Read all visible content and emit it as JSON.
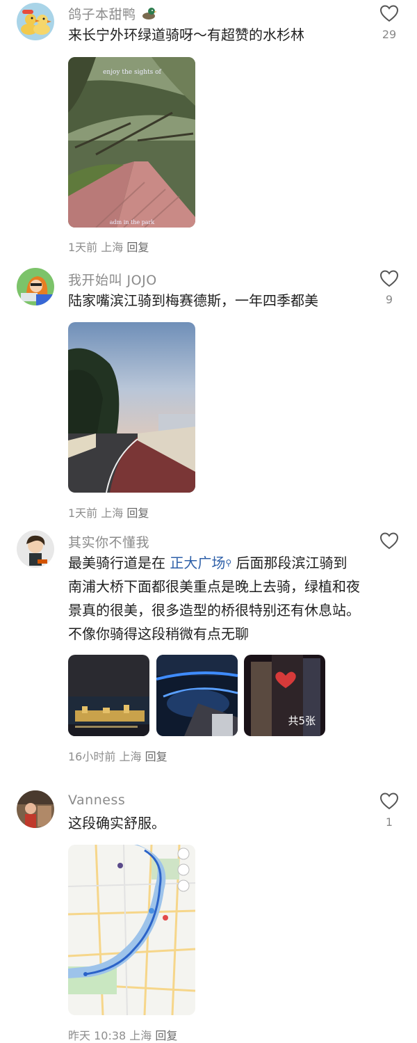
{
  "comments": [
    {
      "username": "鸽子本甜鸭",
      "avatar": "duck-avatar",
      "text": "来长宁外环绿道骑呀～有超赞的水杉林",
      "likes": "29",
      "images": [
        {
          "icon": "forest-path-photo",
          "overlay_top": "enjoy the sights of",
          "overlay_bottom": "adm in the park"
        }
      ],
      "meta": {
        "time": "1天前",
        "location": "上海",
        "reply": "回复"
      }
    },
    {
      "username": "我开始叫 JOJO",
      "avatar": "cartoon-girl-avatar",
      "text": "陆家嘴滨江骑到梅赛德斯，一年四季都美",
      "likes": "9",
      "images": [
        {
          "icon": "riverside-bike-lane-photo"
        }
      ],
      "meta": {
        "time": "1天前",
        "location": "上海",
        "reply": "回复"
      }
    },
    {
      "username": "其实你不懂我",
      "avatar": "cartoon-boy-avatar",
      "text_before": "最美骑行道是在 ",
      "link": "正大广场",
      "text_after": " 后面那段滨江骑到南浦大桥下面都很美重点是晚上去骑，绿植和夜景真的很美，很多造型的桥很特别还有休息站。不像你骑得这段稍微有点无聊",
      "likes": "",
      "images": [
        {
          "icon": "night-skyline-photo"
        },
        {
          "icon": "night-bridge-photo"
        },
        {
          "icon": "night-tower-photo",
          "badge": "共5张"
        }
      ],
      "meta": {
        "time": "16小时前",
        "location": "上海",
        "reply": "回复"
      }
    },
    {
      "username": "Vanness",
      "avatar": "photo-avatar",
      "text": "这段确实舒服。",
      "likes": "1",
      "images": [
        {
          "icon": "route-map-screenshot"
        }
      ],
      "meta": {
        "time": "昨天 10:38",
        "location": "上海",
        "reply": "回复"
      }
    }
  ],
  "colors": {
    "link": "#2d5fa8",
    "username": "#8b8b8b",
    "meta": "#8e8e8e"
  }
}
